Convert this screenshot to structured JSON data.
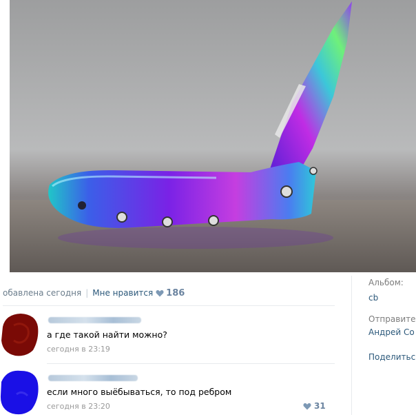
{
  "post": {
    "published_text": "обавлена сегодня",
    "like_label": "Мне нравится",
    "like_count": "186"
  },
  "sidebar": {
    "album_label": "Альбом:",
    "album_value": "cb",
    "sender_label": "Отправите",
    "sender_value": "Андрей Со",
    "share_label": "Поделитьс"
  },
  "comments": [
    {
      "text": "а где такой найти можно?",
      "time": "сегодня в 23:19"
    },
    {
      "text": "если много выёбываться, то под ребром",
      "time": "сегодня в 23:20",
      "likes": "31"
    }
  ],
  "colors": {
    "link": "#2b587a",
    "muted": "#999999",
    "like_blue": "#6b84a0",
    "divider": "#e7eaed",
    "avatar1": "#7a0a06",
    "avatar2": "#1a10e6"
  },
  "icons": [
    "heart-icon"
  ]
}
